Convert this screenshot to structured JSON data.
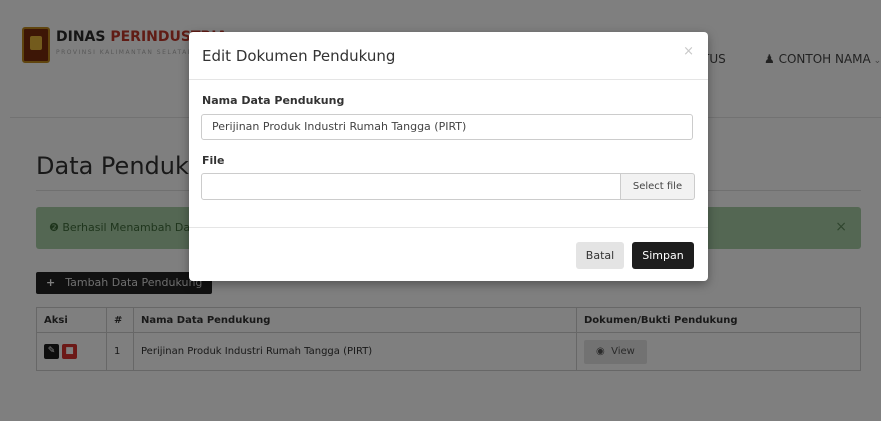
{
  "brand": {
    "name_a": "DINAS ",
    "name_b": "PERINDUSTRIA",
    "subtitle": "PROVINSI KALIMANTAN SELATAN"
  },
  "nav": {
    "status": "TUS",
    "user": "CONTOH NAMA",
    "user_icon": "user-icon",
    "caret": "chevron-down-icon"
  },
  "page": {
    "title": "Data Pendukung"
  },
  "alert": {
    "text": "Berhasil Menambah Da",
    "close": "×"
  },
  "add_button": {
    "label": "Tambah Data Pendukung"
  },
  "table": {
    "headers": [
      "Aksi",
      "#",
      "Nama Data Pendukung",
      "Dokumen/Bukti Pendukung"
    ],
    "rows": [
      {
        "no": "1",
        "name": "Perijinan Produk Industri Rumah Tangga (PIRT)",
        "view": "View"
      }
    ]
  },
  "modal": {
    "title": "Edit Dokumen Pendukung",
    "close": "×",
    "name_label": "Nama Data Pendukung",
    "name_value": "Perijinan Produk Industri Rumah Tangga (PIRT)",
    "file_label": "File",
    "file_value": "",
    "file_button": "Select file",
    "cancel": "Batal",
    "save": "Simpan"
  },
  "colors": {
    "overlay": "#000000",
    "alert_bg": "#a9cfa6",
    "danger": "#d9322e",
    "dark_button": "#1e1e1e"
  }
}
